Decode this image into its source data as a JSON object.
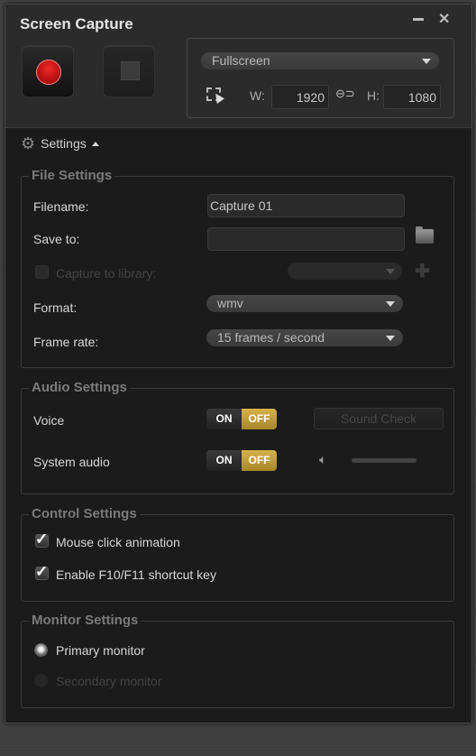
{
  "window": {
    "title": "Screen Capture",
    "minimize_icon": "minimize-icon",
    "close_icon": "close-icon"
  },
  "capture": {
    "record_icon": "record-icon",
    "stop_icon": "stop-icon",
    "mode": "Fullscreen",
    "region_icon": "region-select-icon",
    "width_label": "W:",
    "width_value": "1920",
    "link_icon": "link-icon",
    "height_label": "H:",
    "height_value": "1080"
  },
  "settings_toggle": {
    "label": "Settings",
    "icon": "gear-icon",
    "expanded": true
  },
  "file_settings": {
    "legend": "File Settings",
    "filename_label": "Filename:",
    "filename_value": "Capture 01",
    "save_to_label": "Save to:",
    "save_to_value": "",
    "folder_icon": "folder-icon",
    "capture_to_library_label": "Capture to library:",
    "capture_to_library_checked": false,
    "capture_to_library_enabled": false,
    "library_select_value": "",
    "add_icon": "plus-icon",
    "format_label": "Format:",
    "format_value": "wmv",
    "frame_rate_label": "Frame rate:",
    "frame_rate_value": "15 frames / second"
  },
  "audio_settings": {
    "legend": "Audio Settings",
    "voice_label": "Voice",
    "voice_on_label": "ON",
    "voice_off_label": "OFF",
    "voice_state": "OFF",
    "sound_check_label": "Sound Check",
    "system_audio_label": "System audio",
    "system_on_label": "ON",
    "system_off_label": "OFF",
    "system_audio_state": "OFF",
    "speaker_icon": "speaker-icon"
  },
  "control_settings": {
    "legend": "Control Settings",
    "mouse_click_label": "Mouse click animation",
    "mouse_click_checked": true,
    "shortcut_label": "Enable F10/F11 shortcut key",
    "shortcut_checked": true
  },
  "monitor_settings": {
    "legend": "Monitor Settings",
    "primary_label": "Primary monitor",
    "primary_selected": true,
    "secondary_label": "Secondary monitor",
    "secondary_enabled": false
  },
  "colors": {
    "accent_toggle_off": "#c9a43e",
    "record_red": "#d01818",
    "background": "#1b1b1b"
  }
}
